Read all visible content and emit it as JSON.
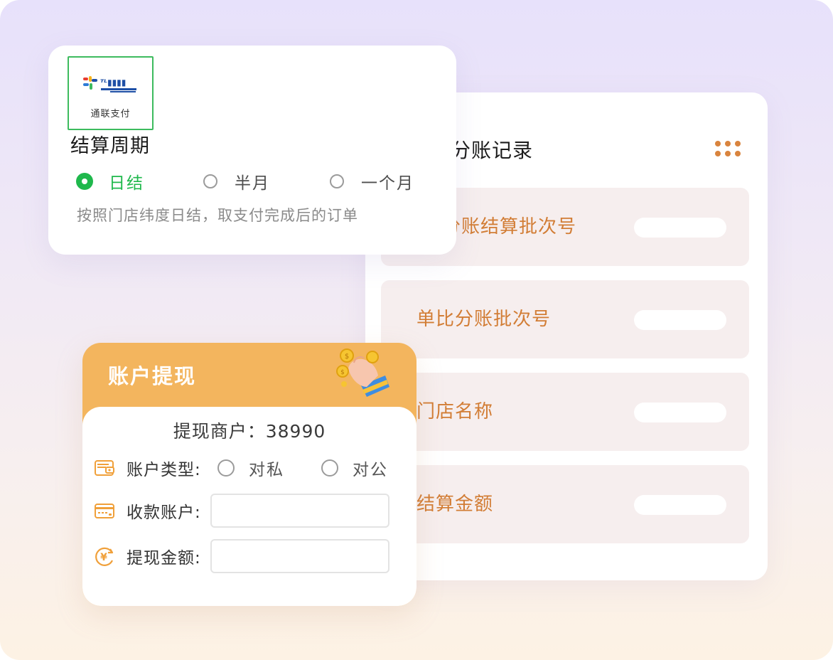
{
  "split_record": {
    "title": "分账记录",
    "rows": [
      {
        "label": "分账结算批次号"
      },
      {
        "label": "单比分账批次号"
      },
      {
        "label": "门店名称"
      },
      {
        "label": "结算金额"
      }
    ]
  },
  "settlement_cycle": {
    "logo_caption": "通联支付",
    "title": "结算周期",
    "options": [
      {
        "label": "日结",
        "selected": true
      },
      {
        "label": "半月",
        "selected": false
      },
      {
        "label": "一个月",
        "selected": false
      }
    ],
    "description": "按照门店纬度日结，取支付完成后的订单"
  },
  "withdraw": {
    "title": "账户提现",
    "merchant_line": "提现商户：38990",
    "account_type_label": "账户类型:",
    "account_types": [
      {
        "label": "对私",
        "selected": false
      },
      {
        "label": "对公",
        "selected": false
      }
    ],
    "receiving_account_label": "收款账户:",
    "receiving_account_value": "",
    "amount_label": "提现金额:",
    "amount_value": ""
  },
  "colors": {
    "accent_orange": "#d27d35",
    "withdraw_header": "#f3b55e",
    "selected_green": "#1fb84c",
    "logo_border": "#3dbb5e"
  }
}
